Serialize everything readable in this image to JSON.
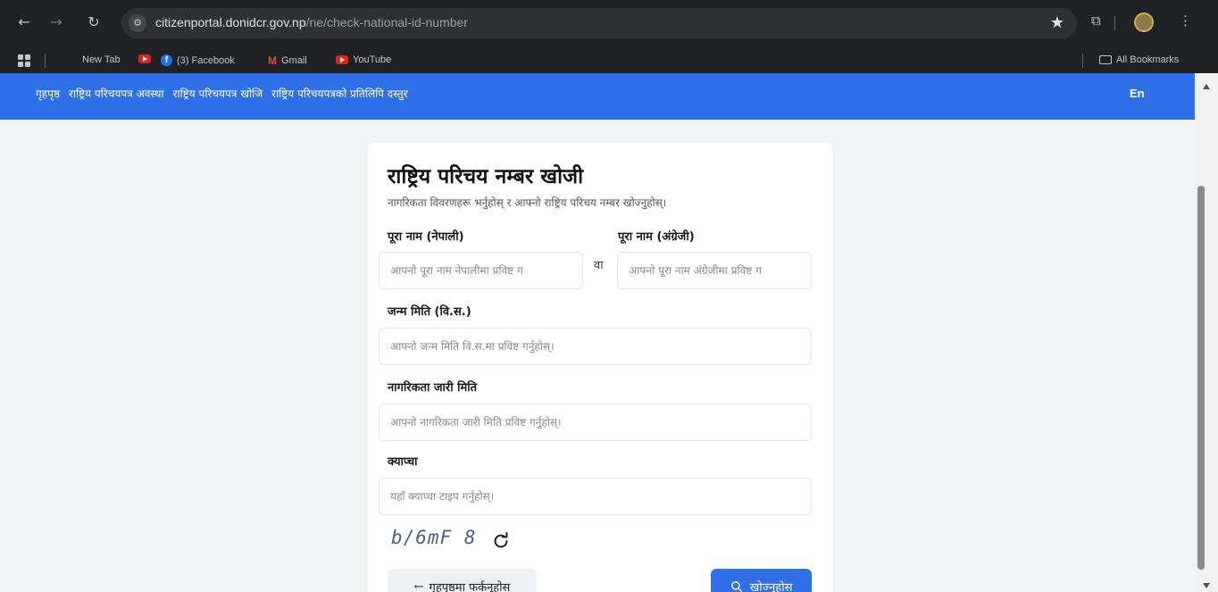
{
  "browser": {
    "url_host": "citizenportal.donidcr.gov.np",
    "url_path": "/ne/check-national-id-number",
    "bookmarks": [
      "New Tab",
      "(3) Facebook",
      "Gmail",
      "YouTube"
    ],
    "all_bookmarks": "All Bookmarks"
  },
  "nav": {
    "links": [
      "गृहपृष्ठ",
      "राष्ट्रिय परिचयपत्र अवस्था",
      "राष्ट्रिय परिचयपत्र खोजि",
      "राष्ट्रिय परिचयपत्रको प्रतिलिपि दस्तुर"
    ],
    "lang": "En"
  },
  "form": {
    "title": "राष्ट्रिय परिचय नम्बर खोजी",
    "subtitle": "नागरिकता विवरणहरू भर्नुहोस् र आफ्नो राष्ट्रिय परिचय नम्बर खोज्नुहोस्।",
    "name_np_label": "पूरा नाम (नेपाली)",
    "name_np_placeholder": "आफ्नो पूरा नाम नेपालीमा प्रविष्ट ग",
    "or": "वा",
    "name_en_label": "पूरा नाम (अंग्रेजी)",
    "name_en_placeholder": "आफ्नो पूरा नाम अंग्रेजीमा प्रविष्ट ग",
    "dob_label": "जन्म मिति (वि.स.)",
    "dob_placeholder": "आफ्नो जन्म मिति वि.स.मा प्रविष्ट गर्नुहोस्।",
    "issue_label": "नागरिकता जारी मिति",
    "issue_placeholder": "आफ्नो नागरिकता जारी मिति प्रविष्ट गर्नुहोस्।",
    "captcha_label": "क्याप्चा",
    "captcha_placeholder": "यहाँ क्याप्चा टाइप गर्नुहोस्।",
    "captcha_text": "b/6mF 8",
    "back_button": "गृहपृष्ठमा फर्कनुहोस",
    "search_button": "खोज्नुहोस"
  },
  "colors": {
    "brand": "#2f6fe8",
    "chrome_dark": "#202124"
  }
}
